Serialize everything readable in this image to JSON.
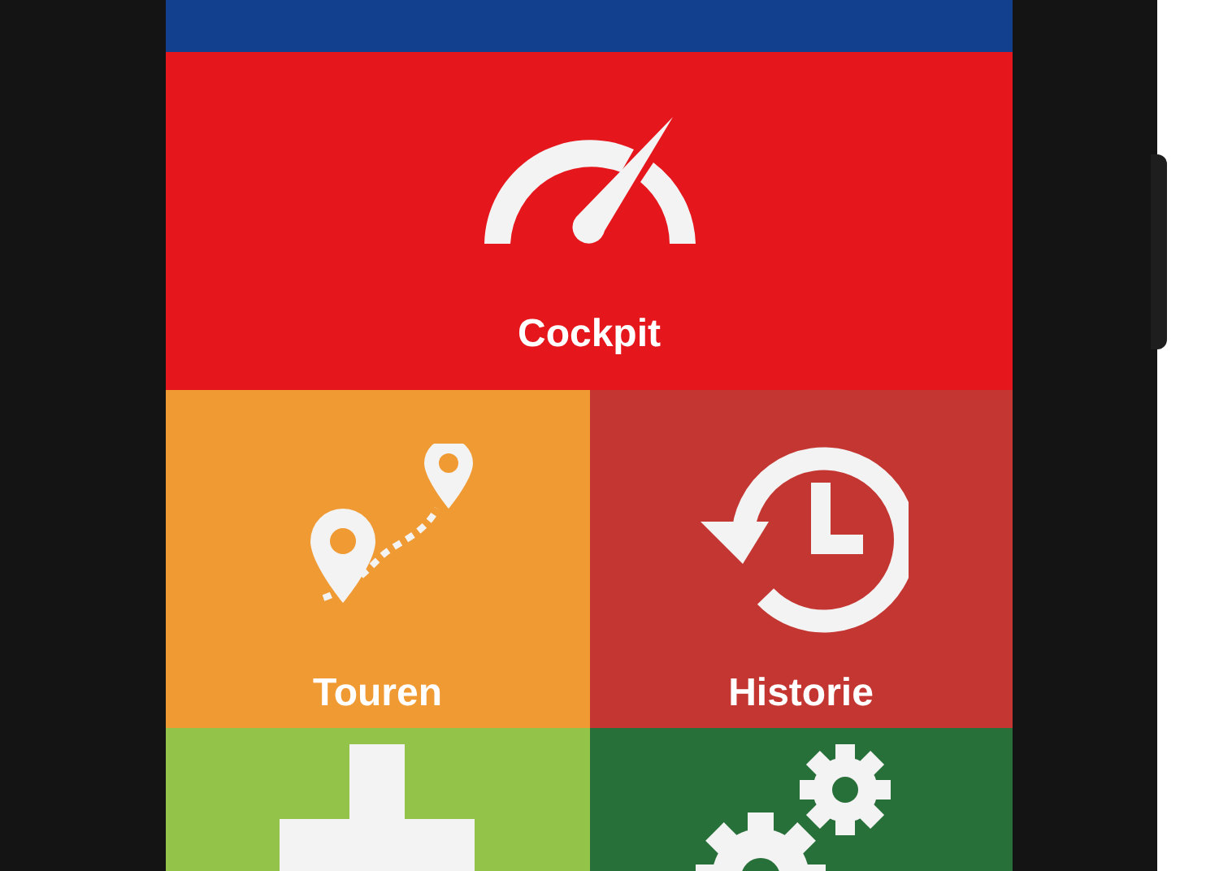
{
  "top_tile": {
    "color": "#133f8f"
  },
  "tiles": [
    {
      "kind": "speedometer",
      "label": "Cockpit",
      "color": "#e5161c",
      "wide": true
    },
    {
      "kind": "route",
      "label": "Touren",
      "color": "#f09a34",
      "wide": false
    },
    {
      "kind": "history",
      "label": "Historie",
      "color": "#c43631",
      "wide": false
    },
    {
      "kind": "plus",
      "color": "#94c349",
      "wide": false
    },
    {
      "kind": "gears",
      "color": "#28703a",
      "wide": false
    }
  ]
}
